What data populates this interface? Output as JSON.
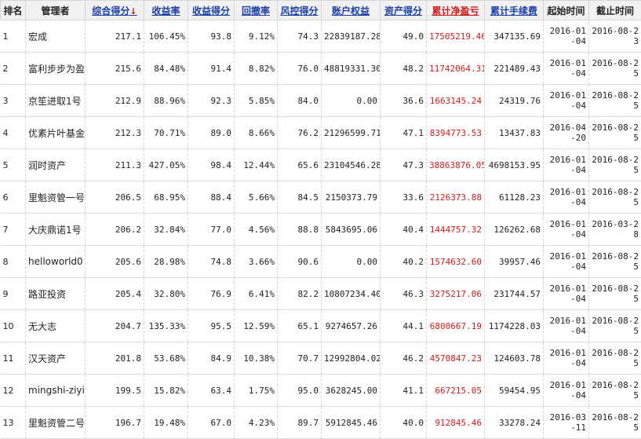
{
  "columns": [
    {
      "key": "rank",
      "label": "排名",
      "style": "plain"
    },
    {
      "key": "manager",
      "label": "管理者",
      "style": "plain"
    },
    {
      "key": "score",
      "label": "综合得分",
      "style": "link",
      "sort_icon": "arrow-down-icon",
      "sort_symbol": "↓"
    },
    {
      "key": "return",
      "label": "收益率",
      "style": "link"
    },
    {
      "key": "return_score",
      "label": "收益得分",
      "style": "link"
    },
    {
      "key": "drawdown",
      "label": "回撤率",
      "style": "link"
    },
    {
      "key": "risk_score",
      "label": "风控得分",
      "style": "link"
    },
    {
      "key": "equity",
      "label": "账户权益",
      "style": "link"
    },
    {
      "key": "asset_score",
      "label": "资产得分",
      "style": "link"
    },
    {
      "key": "net_pnl",
      "label": "累计净盈亏",
      "style": "redlink"
    },
    {
      "key": "fees",
      "label": "累计手续费",
      "style": "link"
    },
    {
      "key": "start",
      "label": "起始时间",
      "style": "plain"
    },
    {
      "key": "end",
      "label": "截止时间",
      "style": "plain"
    }
  ],
  "rows": [
    {
      "rank": "1",
      "manager": "宏成",
      "score": "217.1",
      "return": "106.45%",
      "return_score": "93.8",
      "drawdown": "9.12%",
      "risk_score": "74.3",
      "equity": "22839187.28",
      "asset_score": "49.0",
      "net_pnl": "17505219.46",
      "fees": "347135.69",
      "start": "2016-01-04",
      "end": "2016-08-23"
    },
    {
      "rank": "2",
      "manager": "富利步步为盈",
      "score": "215.6",
      "return": "84.48%",
      "return_score": "91.4",
      "drawdown": "8.82%",
      "risk_score": "76.0",
      "equity": "48819331.30",
      "asset_score": "48.2",
      "net_pnl": "11742064.31",
      "fees": "221489.43",
      "start": "2016-01-04",
      "end": "2016-08-25"
    },
    {
      "rank": "3",
      "manager": "京笙进取1号",
      "score": "212.9",
      "return": "88.96%",
      "return_score": "92.3",
      "drawdown": "5.85%",
      "risk_score": "84.0",
      "equity": "0.00",
      "asset_score": "36.6",
      "net_pnl": "1663145.24",
      "fees": "24319.76",
      "start": "2016-01-04",
      "end": "2016-08-25"
    },
    {
      "rank": "4",
      "manager": "优素片叶基金",
      "score": "212.3",
      "return": "70.71%",
      "return_score": "89.0",
      "drawdown": "8.66%",
      "risk_score": "76.2",
      "equity": "21296599.71",
      "asset_score": "47.1",
      "net_pnl": "8394773.53",
      "fees": "13437.83",
      "start": "2016-04-20",
      "end": "2016-08-25"
    },
    {
      "rank": "5",
      "manager": "润时资产",
      "score": "211.3",
      "return": "427.05%",
      "return_score": "98.4",
      "drawdown": "12.44%",
      "risk_score": "65.6",
      "equity": "23104546.28",
      "asset_score": "47.3",
      "net_pnl": "38863876.05",
      "fees": "4698153.95",
      "start": "2016-01-04",
      "end": "2016-08-25"
    },
    {
      "rank": "6",
      "manager": "里魁资管一号",
      "score": "206.5",
      "return": "68.95%",
      "return_score": "88.4",
      "drawdown": "5.66%",
      "risk_score": "84.5",
      "equity": "2150373.79",
      "asset_score": "33.6",
      "net_pnl": "2126373.88",
      "fees": "61128.23",
      "start": "2016-01-04",
      "end": "2016-08-25"
    },
    {
      "rank": "7",
      "manager": "大庆鼎诺1号",
      "score": "206.2",
      "return": "32.84%",
      "return_score": "77.0",
      "drawdown": "4.56%",
      "risk_score": "88.8",
      "equity": "5843695.06",
      "asset_score": "40.4",
      "net_pnl": "1444757.32",
      "fees": "126262.68",
      "start": "2016-01-04",
      "end": "2016-03-28"
    },
    {
      "rank": "8",
      "manager": "helloworld0",
      "score": "205.6",
      "return": "28.98%",
      "return_score": "74.8",
      "drawdown": "3.66%",
      "risk_score": "90.6",
      "equity": "0.00",
      "asset_score": "40.2",
      "net_pnl": "1574632.60",
      "fees": "39957.46",
      "start": "2016-01-04",
      "end": "2016-08-25"
    },
    {
      "rank": "9",
      "manager": "路亚投资",
      "score": "205.4",
      "return": "32.80%",
      "return_score": "76.9",
      "drawdown": "6.41%",
      "risk_score": "82.2",
      "equity": "10807234.40",
      "asset_score": "46.3",
      "net_pnl": "3275217.06",
      "fees": "231744.57",
      "start": "2016-01-04",
      "end": "2016-08-25"
    },
    {
      "rank": "10",
      "manager": "无大志",
      "score": "204.7",
      "return": "135.33%",
      "return_score": "95.5",
      "drawdown": "12.59%",
      "risk_score": "65.1",
      "equity": "9274657.26",
      "asset_score": "44.1",
      "net_pnl": "6800667.19",
      "fees": "1174228.03",
      "start": "2016-01-04",
      "end": "2016-08-25"
    },
    {
      "rank": "11",
      "manager": "汉天资产",
      "score": "201.8",
      "return": "53.68%",
      "return_score": "84.9",
      "drawdown": "10.38%",
      "risk_score": "70.7",
      "equity": "12992804.02",
      "asset_score": "46.2",
      "net_pnl": "4570847.23",
      "fees": "124603.78",
      "start": "2016-01-04",
      "end": "2016-08-25"
    },
    {
      "rank": "12",
      "manager": "mingshi-ziyi",
      "score": "199.5",
      "return": "15.82%",
      "return_score": "63.4",
      "drawdown": "1.75%",
      "risk_score": "95.0",
      "equity": "3628245.00",
      "asset_score": "41.1",
      "net_pnl": "667215.05",
      "fees": "59454.95",
      "start": "2016-01-04",
      "end": "2016-08-25"
    },
    {
      "rank": "13",
      "manager": "里魁资管二号",
      "score": "196.7",
      "return": "19.48%",
      "return_score": "67.0",
      "drawdown": "4.23%",
      "risk_score": "89.7",
      "equity": "5912845.46",
      "asset_score": "40.0",
      "net_pnl": "912845.46",
      "fees": "33278.24",
      "start": "2016-03-11",
      "end": "2016-08-25"
    }
  ],
  "colors": {
    "link": "#1a3ea8",
    "highlight": "#d11b1b",
    "header_bg": "#f1f1f1"
  }
}
